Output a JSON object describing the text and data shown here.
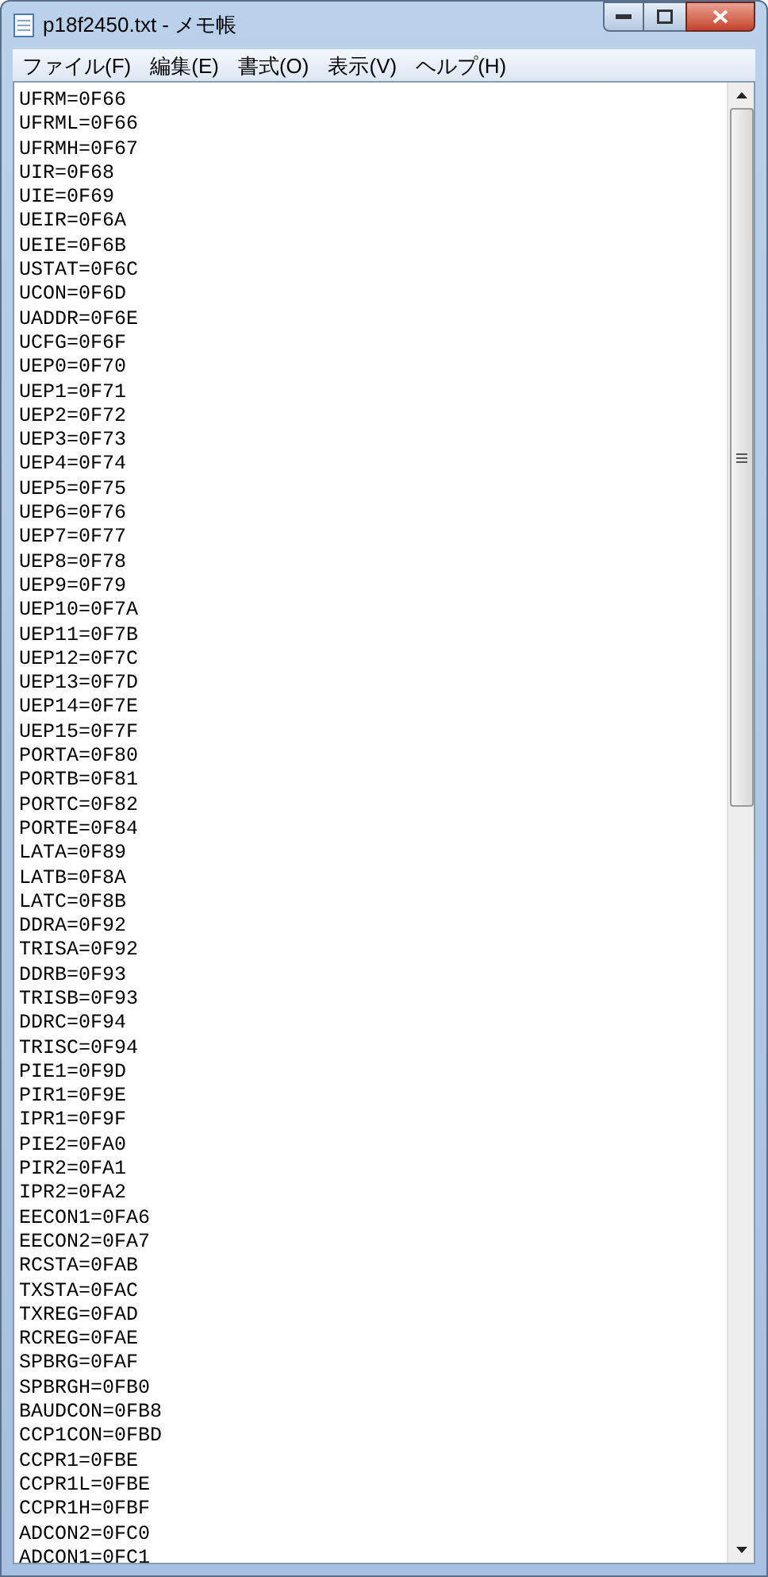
{
  "window": {
    "title": "p18f2450.txt - メモ帳"
  },
  "menu": [
    "ファイル(F)",
    "編集(E)",
    "書式(O)",
    "表示(V)",
    "ヘルプ(H)"
  ],
  "lines": [
    "UFRM=0F66",
    "UFRML=0F66",
    "UFRMH=0F67",
    "UIR=0F68",
    "UIE=0F69",
    "UEIR=0F6A",
    "UEIE=0F6B",
    "USTAT=0F6C",
    "UCON=0F6D",
    "UADDR=0F6E",
    "UCFG=0F6F",
    "UEP0=0F70",
    "UEP1=0F71",
    "UEP2=0F72",
    "UEP3=0F73",
    "UEP4=0F74",
    "UEP5=0F75",
    "UEP6=0F76",
    "UEP7=0F77",
    "UEP8=0F78",
    "UEP9=0F79",
    "UEP10=0F7A",
    "UEP11=0F7B",
    "UEP12=0F7C",
    "UEP13=0F7D",
    "UEP14=0F7E",
    "UEP15=0F7F",
    "PORTA=0F80",
    "PORTB=0F81",
    "PORTC=0F82",
    "PORTE=0F84",
    "LATA=0F89",
    "LATB=0F8A",
    "LATC=0F8B",
    "DDRA=0F92",
    "TRISA=0F92",
    "DDRB=0F93",
    "TRISB=0F93",
    "DDRC=0F94",
    "TRISC=0F94",
    "PIE1=0F9D",
    "PIR1=0F9E",
    "IPR1=0F9F",
    "PIE2=0FA0",
    "PIR2=0FA1",
    "IPR2=0FA2",
    "EECON1=0FA6",
    "EECON2=0FA7",
    "RCSTA=0FAB",
    "TXSTA=0FAC",
    "TXREG=0FAD",
    "RCREG=0FAE",
    "SPBRG=0FAF",
    "SPBRGH=0FB0",
    "BAUDCON=0FB8",
    "CCP1CON=0FBD",
    "CCPR1=0FBE",
    "CCPR1L=0FBE",
    "CCPR1H=0FBF",
    "ADCON2=0FC0",
    "ADCON1=0FC1"
  ]
}
